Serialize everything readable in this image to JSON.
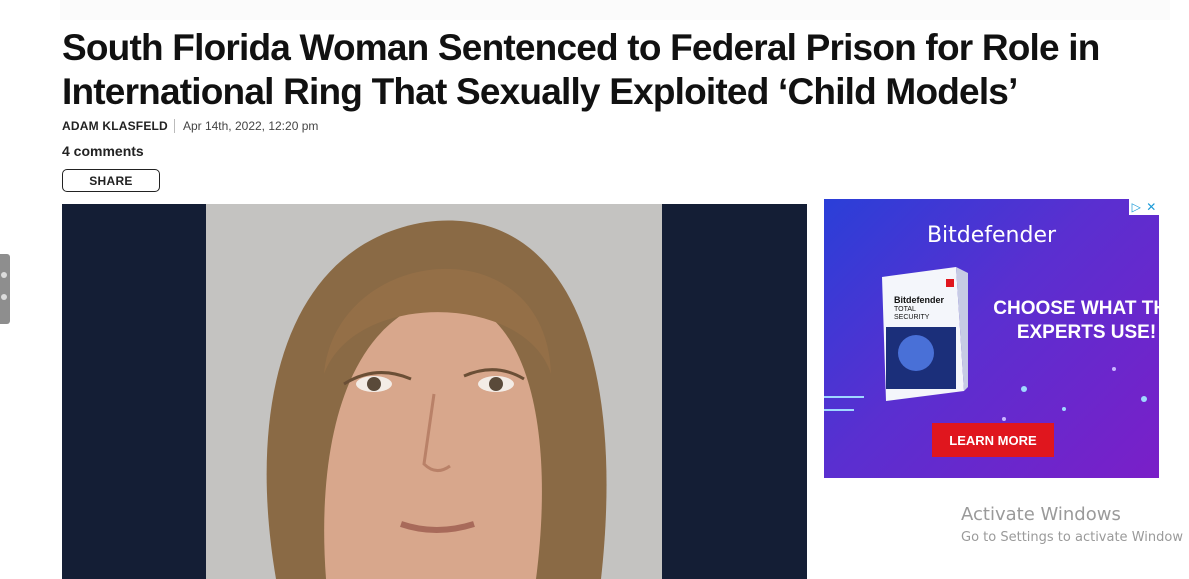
{
  "article": {
    "headline": "South Florida Woman Sentenced to Federal Prison for Role in International Ring That Sexually Exploited ‘Child Models’",
    "author": "ADAM KLASFELD",
    "date": "Apr 14th, 2022, 12:20 pm",
    "comments": "4 comments",
    "share_label": "SHARE"
  },
  "ad": {
    "brand": "Bitdefender",
    "box_brand": "Bitdefender",
    "box_product": "TOTAL SECURITY",
    "tagline": "CHOOSE WHAT THE EXPERTS USE!",
    "cta": "LEARN MORE",
    "colors": {
      "cta": "#e0161e",
      "bg_start": "#2a3fd8",
      "bg_end": "#7a1fc8"
    }
  },
  "watermark": {
    "title": "Activate Windows",
    "subtitle": "Go to Settings to activate Window"
  },
  "colors": {
    "hero_bg": "#141e35"
  }
}
